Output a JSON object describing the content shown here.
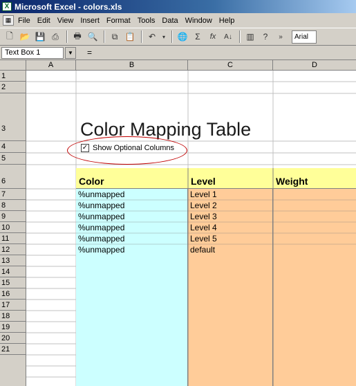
{
  "window": {
    "title": "Microsoft Excel - colors.xls"
  },
  "menu": [
    "File",
    "Edit",
    "View",
    "Insert",
    "Format",
    "Tools",
    "Data",
    "Window",
    "Help"
  ],
  "toolbar": {
    "font": "Arial"
  },
  "formula_bar": {
    "name_box": "Text Box 1",
    "equals": "="
  },
  "columns": [
    "A",
    "B",
    "C",
    "D"
  ],
  "rows": [
    "1",
    "2",
    "3",
    "4",
    "5",
    "6",
    "7",
    "8",
    "9",
    "10",
    "11",
    "12",
    "13",
    "14",
    "15",
    "16",
    "17",
    "18",
    "19",
    "20",
    "21"
  ],
  "sheet": {
    "title": "Color Mapping Table",
    "checkbox_label": "Show Optional Columns",
    "checkbox_checked": true,
    "headers": {
      "color": "Color",
      "level": "Level",
      "weight": "Weight"
    },
    "colors": [
      "%unmapped",
      "%unmapped",
      "%unmapped",
      "%unmapped",
      "%unmapped",
      "%unmapped"
    ],
    "levels": [
      "Level 1",
      "Level 2",
      "Level 3",
      "Level 4",
      "Level 5",
      "default"
    ]
  },
  "fill_colors": {
    "color_column": "#ccffff",
    "level_column": "#ffcc99",
    "header_row": "#ffff99",
    "annotation": "#c00000"
  }
}
